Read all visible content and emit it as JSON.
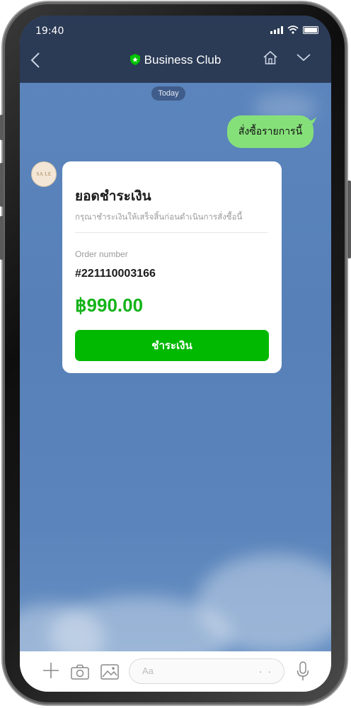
{
  "status": {
    "time": "19:40"
  },
  "header": {
    "title": "Business Club"
  },
  "chat": {
    "date_label": "Today",
    "outgoing_message": "สั่งซื้อรายการนี้",
    "avatar_text": "SA LE"
  },
  "card": {
    "title": "ยอดชำระเงิน",
    "subtitle": "กรุณาชำระเงินให้เสร็จสิ้นก่อนดำเนินการสั่งซื้อนี้",
    "order_label": "Order number",
    "order_number": "#221110003166",
    "amount": "฿990.00",
    "pay_button": "ชำระเงิน"
  },
  "input": {
    "placeholder": "Aa",
    "emoji": "· ·"
  },
  "colors": {
    "header_bg": "#2b3a55",
    "chat_bg": "#5c86bd",
    "outgoing_bubble": "#86e07a",
    "line_green": "#00b900",
    "amount": "#15b31a"
  },
  "icons": [
    "back-icon",
    "shield-icon",
    "home-icon",
    "chevron-down-icon",
    "plus-icon",
    "camera-icon",
    "image-icon",
    "mic-icon"
  ]
}
